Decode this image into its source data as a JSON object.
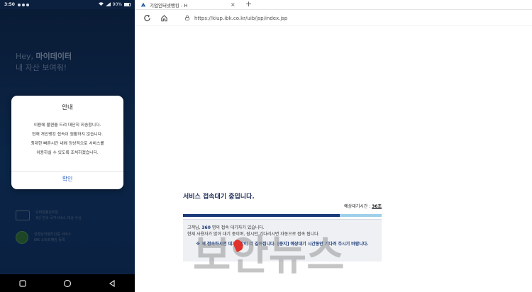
{
  "phone": {
    "status_time": "3:50",
    "status_battery": "90%",
    "hero_line1_prefix": "Hey, ",
    "hero_line1_strong": "마이데이터",
    "hero_line2": "내 자산 보여줘!",
    "awards": [
      {
        "line1": "모바일뱅킹부문",
        "line2": "3년 연속 국가서비스 대상 수상"
      },
      {
        "line1": "한경상처뱅지인증 서비스",
        "line2": "IBK 스마트뱅킹 등록"
      }
    ],
    "dialog": {
      "title": "안내",
      "body": [
        "이용에 불편을 드려 대단히 죄송합니다.",
        "현재 개인뱅킹 접속이 원활하지 않습니다.",
        "최대한 빠른시간 내에 정상적으로 서비스를",
        "이용하실 수 있도록 조치하겠습니다."
      ],
      "ok_label": "확인"
    },
    "colors": {
      "bg": "#123a6e",
      "accent": "#2f63c6"
    }
  },
  "browser": {
    "tab_title": "기업인터넷뱅킹 - H",
    "tab_close": "×",
    "new_tab": "+",
    "url": "https://kiup.ibk.co.kr/uib/jsp/index.jsp"
  },
  "queue": {
    "title": "서비스 접속대기 중입니다.",
    "eta_label": "예상대기시간 : ",
    "eta_value": "36초",
    "progress": 0.79,
    "line1_prefix": "고객님, ",
    "line1_count": "360",
    "line1_suffix": " 명의 접속 대기자가 있습니다.",
    "line2": "현재 사용자가 많아 대기 중이며, 잠시만 기다리시면 자동으로 접속 됩니다.",
    "warning": "※ 재 접속하시면 대기시간이 더 길어집니다. [중지] 예상대기 시간동안 기다려 주시기 바랍니다.",
    "colors": {
      "navy": "#1b3a7a",
      "track": "#9fd0ea"
    }
  },
  "watermark": "보안뉴스"
}
